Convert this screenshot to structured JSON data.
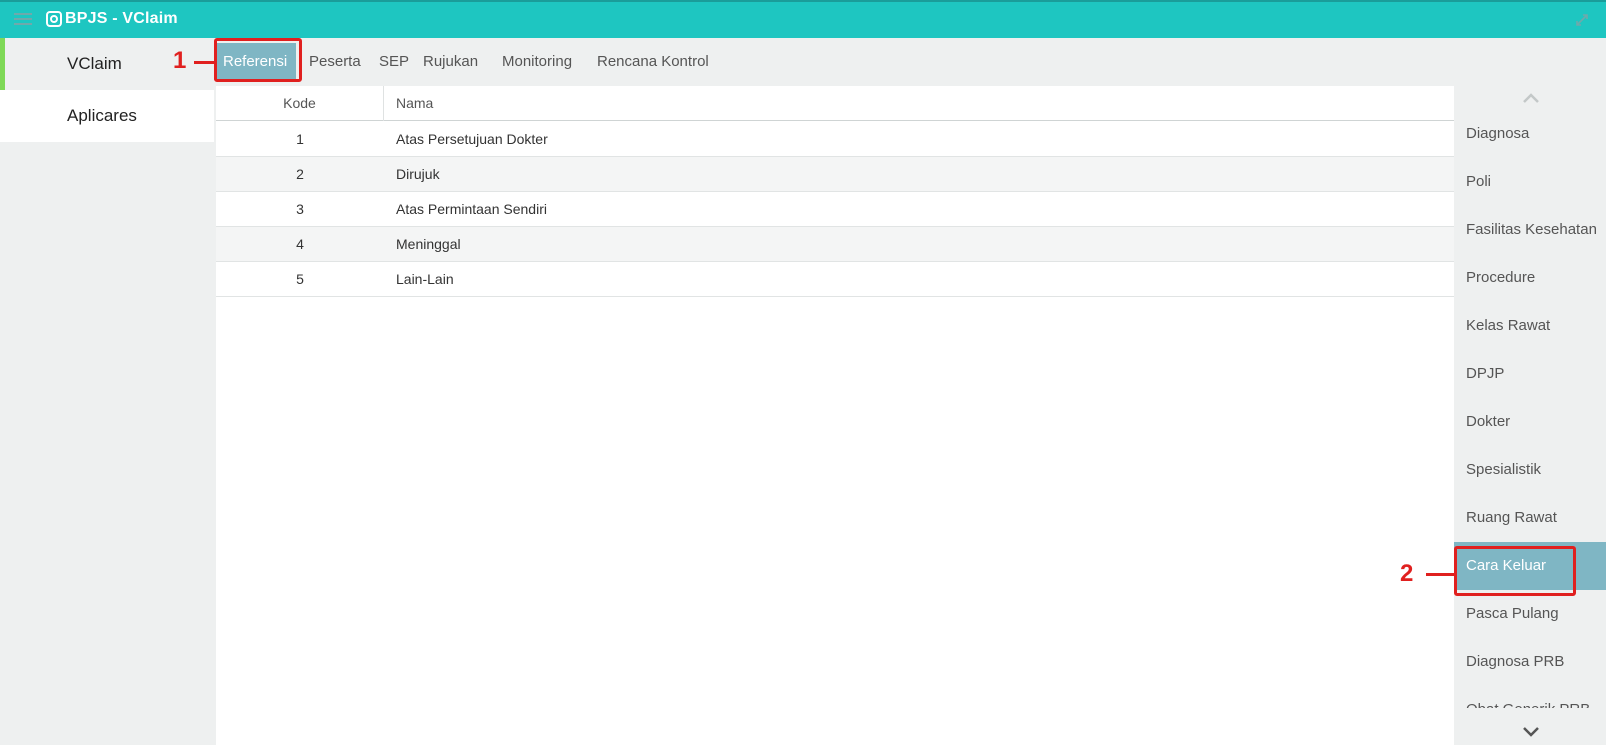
{
  "app": {
    "title": "BPJS - VClaim"
  },
  "sidebar": {
    "items": [
      {
        "label": "VClaim"
      },
      {
        "label": "Aplicares"
      }
    ]
  },
  "tabs": [
    {
      "label": "Referensi"
    },
    {
      "label": "Peserta"
    },
    {
      "label": "SEP"
    },
    {
      "label": "Rujukan"
    },
    {
      "label": "Monitoring"
    },
    {
      "label": "Rencana Kontrol"
    }
  ],
  "table": {
    "headers": {
      "kode": "Kode",
      "nama": "Nama"
    },
    "rows": [
      {
        "kode": "1",
        "nama": "Atas Persetujuan Dokter"
      },
      {
        "kode": "2",
        "nama": "Dirujuk"
      },
      {
        "kode": "3",
        "nama": "Atas Permintaan Sendiri"
      },
      {
        "kode": "4",
        "nama": "Meninggal"
      },
      {
        "kode": "5",
        "nama": "Lain-Lain"
      }
    ]
  },
  "right_nav": {
    "items": [
      {
        "label": "Diagnosa"
      },
      {
        "label": "Poli"
      },
      {
        "label": "Fasilitas Kesehatan"
      },
      {
        "label": "Procedure"
      },
      {
        "label": "Kelas Rawat"
      },
      {
        "label": "DPJP"
      },
      {
        "label": "Dokter"
      },
      {
        "label": "Spesialistik"
      },
      {
        "label": "Ruang Rawat"
      },
      {
        "label": "Cara Keluar"
      },
      {
        "label": "Pasca Pulang"
      },
      {
        "label": "Diagnosa PRB"
      },
      {
        "label": "Obat Generik PRB"
      }
    ],
    "active": "Cara Keluar"
  },
  "annotations": [
    {
      "number": "1"
    },
    {
      "number": "2"
    }
  ],
  "colors": {
    "header": "#1ec6c1",
    "active_tab": "#7fb6c4",
    "annotation": "#e0201f",
    "sidebar_accent": "#7ed957"
  },
  "icons": {
    "menu": "hamburger-icon",
    "logo": "bpjs-logo-icon",
    "expand": "expand-icon",
    "scroll_up": "chevron-up-icon",
    "scroll_down": "chevron-down-icon"
  }
}
